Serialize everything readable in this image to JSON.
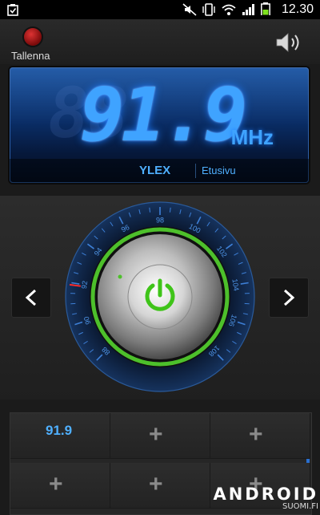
{
  "status_bar": {
    "time": "12.30",
    "icons": [
      "notification-icon",
      "mute-icon",
      "vibrate-icon",
      "wifi-icon",
      "signal-icon",
      "battery-icon"
    ]
  },
  "top_bar": {
    "record_label": "Tallenna",
    "speaker_icon": "speaker-icon"
  },
  "display": {
    "frequency": "91.9",
    "ghost": "88",
    "unit": "MHz",
    "station_name": "YLEX",
    "station_page": "Etusivu"
  },
  "dial": {
    "scale": [
      "88",
      "90",
      "92",
      "94",
      "96",
      "98",
      "100",
      "102",
      "104",
      "106",
      "108"
    ],
    "current_value": 91.9,
    "power_icon": "power-icon",
    "accent": "#4dc02b"
  },
  "presets": {
    "items": [
      {
        "label": "91.9",
        "empty": false
      },
      {
        "label": "+",
        "empty": true
      },
      {
        "label": "+",
        "empty": true
      },
      {
        "label": "+",
        "empty": true
      },
      {
        "label": "+",
        "empty": true
      },
      {
        "label": "+",
        "empty": true
      }
    ]
  },
  "watermark": {
    "big": "ANDROID",
    "small": "SUOMI.FI"
  },
  "colors": {
    "display_blue": "#3fa3ff",
    "record_red": "#d33333"
  }
}
